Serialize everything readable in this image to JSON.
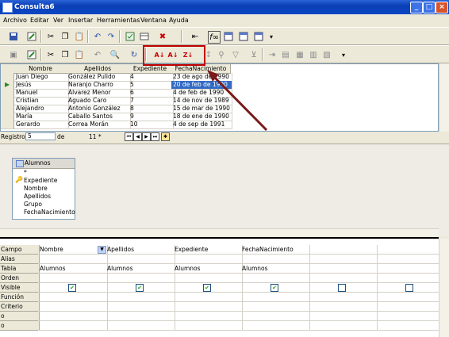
{
  "window": {
    "title": "Consulta6",
    "min": "_",
    "max": "□",
    "close": "×"
  },
  "menubar": [
    "Archivo",
    "Editar",
    "Ver",
    "Insertar",
    "Herramientas",
    "Ventana",
    "Ayuda"
  ],
  "toolbar1": {
    "icons": [
      "save-icon",
      "edit-icon",
      "cut-icon",
      "copy-icon",
      "paste-icon",
      "undo-icon",
      "redo-icon",
      "design-icon",
      "query-icon",
      "delete-icon",
      "arrow-icon",
      "function-icon",
      "table-icon",
      "alias-icon",
      "more-icon"
    ]
  },
  "toolbar2": {
    "sort_asc": "A↓",
    "sort_asc2": "A↓",
    "sort_desc": "Z↓",
    "icons": [
      "save-icon",
      "edit-icon",
      "cut-icon",
      "copy-icon",
      "paste-icon",
      "undo-icon",
      "find-icon"
    ]
  },
  "results": {
    "columns": [
      "Nombre",
      "Apellidos",
      "Expediente",
      "FechaNacimiento"
    ],
    "rows": [
      [
        "Juan Diego",
        "González Pulido",
        "4",
        "23 de ago de 1990"
      ],
      [
        "Jesús",
        "Naranjo Charro",
        "5",
        "20 de feb de 1990"
      ],
      [
        "Manuel",
        "Álvarez Menor",
        "6",
        "4 de feb de 1990"
      ],
      [
        "Cristian",
        "Aguado Caro",
        "7",
        "14 de nov de 1989"
      ],
      [
        "Alejandro",
        "Antonio González",
        "8",
        "15 de mar de 1990"
      ],
      [
        "María",
        "Caballo Santos",
        "9",
        "18 de ene de 1990"
      ],
      [
        "Gerardo",
        "Correa Morán",
        "10",
        "4 de sep de 1991"
      ]
    ]
  },
  "record_nav": {
    "label": "Registro",
    "current": "5",
    "of": "de",
    "total": "11 *"
  },
  "table_box": {
    "title": "Alumnos",
    "fields": [
      "*",
      "Expediente",
      "Nombre",
      "Apellidos",
      "Grupo",
      "FechaNacimiento"
    ]
  },
  "criteria": {
    "labels": [
      "Campo",
      "Alias",
      "Tabla",
      "Orden",
      "Visible",
      "Función",
      "Criterio",
      "o",
      "o"
    ],
    "columns": [
      {
        "campo": "Nombre",
        "tabla": "Alumnos",
        "visible": true
      },
      {
        "campo": "Apellidos",
        "tabla": "Alumnos",
        "visible": true
      },
      {
        "campo": "Expediente",
        "tabla": "Alumnos",
        "visible": true
      },
      {
        "campo": "FechaNacimiento",
        "tabla": "Alumnos",
        "visible": true
      },
      {
        "campo": "",
        "tabla": "",
        "visible": false
      },
      {
        "campo": "",
        "tabla": "",
        "visible": false
      }
    ]
  },
  "colors": {
    "annotation": "#c00000",
    "arrow": "#7a1a1a",
    "selection": "#316ac5"
  }
}
